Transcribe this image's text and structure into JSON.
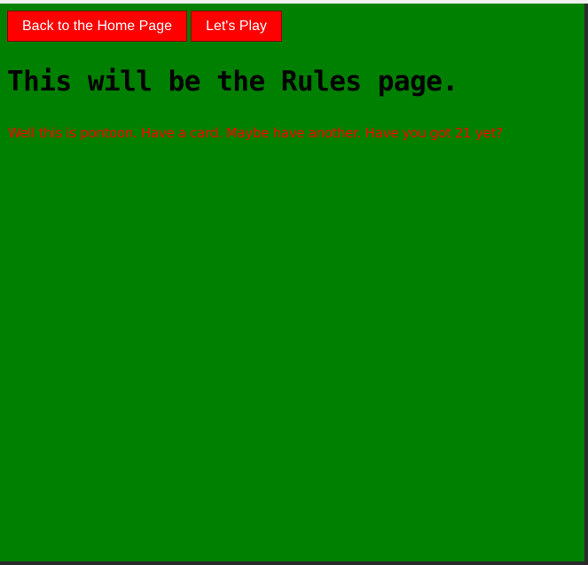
{
  "nav": {
    "home_button": "Back to the Home Page",
    "play_button": "Let's Play"
  },
  "main": {
    "title": "This will be the Rules page.",
    "text": "Well this is pontoon. Have a card. Maybe have another. Have you got 21 yet?"
  },
  "colors": {
    "background": "#008000",
    "button": "#ff0000",
    "text": "#ff0000"
  }
}
